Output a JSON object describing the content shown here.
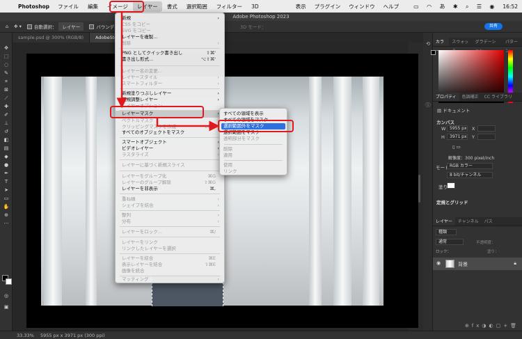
{
  "menubar": {
    "app_name": "Photoshop",
    "items": [
      "ファイル",
      "編集",
      "イメージ",
      "レイヤー",
      "書式",
      "選択範囲",
      "フィルター",
      "3D"
    ],
    "right_items": [
      "表示",
      "プラグイン",
      "ウィンドウ",
      "ヘルプ"
    ],
    "time": "16:52"
  },
  "window": {
    "title": "Adobe Photoshop 2023"
  },
  "optbar": {
    "auto_select": "自動選択：",
    "layer_select": "レイヤー",
    "bounding": "バウンディ",
    "mode_3d": "3D モード：",
    "share": "共有"
  },
  "tabs": [
    {
      "label": "sample.psd @ 300% (RGB/8)"
    },
    {
      "label": "AdobeStoc"
    }
  ],
  "layer_menu": {
    "items": {
      "new": "新規",
      "copy_css": "CSS をコピー",
      "copy_svg": "SVG をコピー",
      "duplicate": "レイヤーを複製...",
      "delete": "削除",
      "quick_export": "PNG としてクイック書き出し",
      "quick_export_sc": "⇧⌘'",
      "export_as": "書き出し形式...",
      "export_as_sc": "⌥⇧⌘'",
      "rename": "レイヤー名の変更...",
      "layer_style": "レイヤースタイル",
      "smart_filter": "スマートフィルター",
      "new_fill": "新規塗りつぶしレイヤー",
      "new_adjust": "新規調整レイヤー",
      "layer_options": "レイヤーオプション...",
      "layer_mask": "レイヤーマスク",
      "vector_mask": "ベクトルマスク",
      "clipping_mask": "クリッピングマスクを作成",
      "clipping_mask_sc": "⌥⌘G",
      "mask_all": "すべてのオブジェクトをマスク",
      "smart_object": "スマートオブジェクト",
      "video_layer": "ビデオレイヤー",
      "rasterize": "ラスタライズ",
      "slice": "レイヤーに基づく新規スライス",
      "group": "レイヤーをグループ化",
      "group_sc": "⌘G",
      "ungroup": "レイヤーのグループ解除",
      "ungroup_sc": "⇧⌘G",
      "hide": "レイヤーを非表示",
      "hide_sc": "⌘,",
      "arrange": "重ね順",
      "combine": "シェイプを結合",
      "align": "整列",
      "distribute": "分布",
      "lock": "レイヤーをロック...",
      "lock_sc": "⌘/",
      "link": "レイヤーをリンク",
      "select_linked": "リンクしたレイヤーを選択",
      "merge": "レイヤーを結合",
      "merge_sc": "⌘E",
      "merge_visible": "表示レイヤーを結合",
      "merge_visible_sc": "⇧⌘E",
      "flatten": "画像を統合",
      "matting": "マッティング"
    }
  },
  "mask_submenu": {
    "reveal_all": "すべての領域を表示",
    "hide_all": "すべての領域をマスク",
    "reveal_selection": "選択範囲外をマスク",
    "hide_selection": "選択範囲をマスク",
    "from_transparency": "透明部分をマスク",
    "delete": "削除",
    "apply": "適用",
    "enable": "使用",
    "link": "リンク"
  },
  "color_panel": {
    "tabs": [
      "カラー",
      "スウォッチ",
      "グラデーション",
      "パターン"
    ]
  },
  "props_panel": {
    "tabs": [
      "プロパティ",
      "色調補正",
      "CC ライブラリ"
    ],
    "doc_label": "ドキュメント",
    "canvas_title": "カンバス",
    "w_label": "W",
    "w_value": "5955 px",
    "h_label": "H",
    "h_value": "3971 px",
    "x_label": "X",
    "y_label": "Y",
    "resolution": "解像度：300 pixel/inch",
    "mode_label": "モード",
    "mode_value": "RGB カラー",
    "depth_value": "8 bit/チャンネル",
    "fill_label": "塗り",
    "rulers_title": "定規とグリッド"
  },
  "layers_panel": {
    "tabs": [
      "レイヤー",
      "チャンネル",
      "パス"
    ],
    "kind": "種類",
    "blend": "通常",
    "opacity_label": "不透明度：",
    "lock_label": "ロック：",
    "fill_label": "塗り：",
    "layer_name": "背景"
  },
  "statusbar": {
    "zoom": "33.33%",
    "info": "5955 px x 3971 px (300 ppi)"
  },
  "colors": {
    "highlight_red": "#e0191e",
    "menu_select": "#2f6fe0",
    "accent": "#1473e6"
  }
}
